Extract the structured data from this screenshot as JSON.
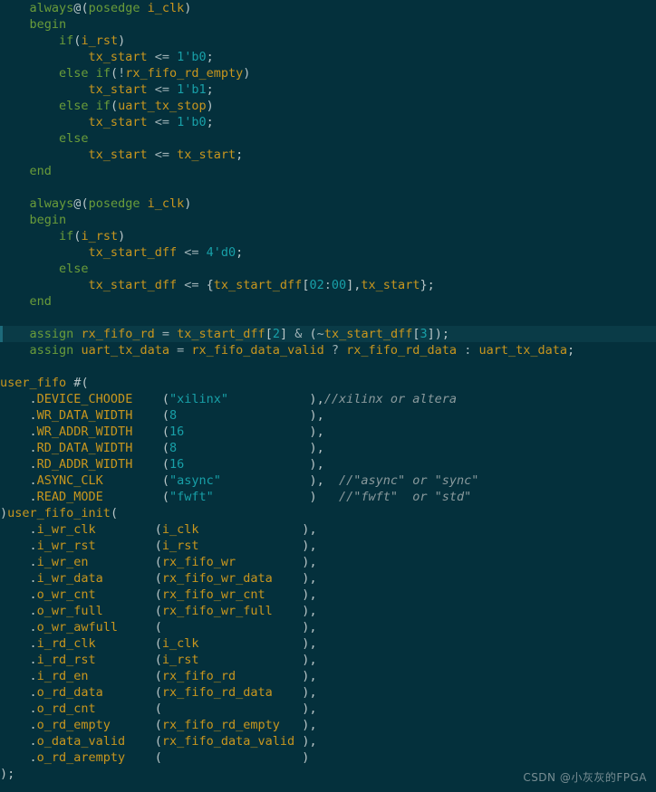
{
  "editor": {
    "language": "verilog",
    "background_color": "#04303c",
    "highlight_color": "#0a3b47",
    "highlight_bar_color": "#1d6a7a",
    "colors": {
      "keyword": "#6a9c3a",
      "identifier": "#c8961e",
      "number": "#18a0a8",
      "string": "#18a0a8",
      "punctuation": "#b9c6c8",
      "operator": "#9fb2b6",
      "comment": "#8a9a9d"
    },
    "highlighted_line_index": 20
  },
  "watermark": {
    "text": "CSDN @小灰灰的FPGA"
  },
  "code": {
    "lines": [
      "    always@(posedge i_clk)",
      "    begin",
      "        if(i_rst)",
      "            tx_start <= 1'b0;",
      "        else if(!rx_fifo_rd_empty)",
      "            tx_start <= 1'b1;",
      "        else if(uart_tx_stop)",
      "            tx_start <= 1'b0;",
      "        else",
      "            tx_start <= tx_start;",
      "    end",
      "",
      "    always@(posedge i_clk)",
      "    begin",
      "        if(i_rst)",
      "            tx_start_dff <= 4'd0;",
      "        else",
      "            tx_start_dff <= {tx_start_dff[02:00],tx_start};",
      "    end",
      "",
      "    assign rx_fifo_rd = tx_start_dff[2] & (~tx_start_dff[3]);",
      "    assign uart_tx_data = rx_fifo_data_valid ? rx_fifo_rd_data : uart_tx_data;",
      "",
      "user_fifo #(",
      "    .DEVICE_CHOODE    (\"xilinx\"           ),//xilinx or altera",
      "    .WR_DATA_WIDTH    (8                  ),",
      "    .WR_ADDR_WIDTH    (16                 ),",
      "    .RD_DATA_WIDTH    (8                  ),",
      "    .RD_ADDR_WIDTH    (16                 ),",
      "    .ASYNC_CLK        (\"async\"            ),  //\"async\" or \"sync\"",
      "    .READ_MODE        (\"fwft\"             )   //\"fwft\"  or \"std\"",
      ")user_fifo_init(",
      "    .i_wr_clk        (i_clk              ),",
      "    .i_wr_rst        (i_rst              ),",
      "    .i_wr_en         (rx_fifo_wr         ),",
      "    .i_wr_data       (rx_fifo_wr_data    ),",
      "    .o_wr_cnt        (rx_fifo_wr_cnt     ),",
      "    .o_wr_full       (rx_fifo_wr_full    ),",
      "    .o_wr_awfull     (                   ),",
      "    .i_rd_clk        (i_clk              ),",
      "    .i_rd_rst        (i_rst              ),",
      "    .i_rd_en         (rx_fifo_rd         ),",
      "    .o_rd_data       (rx_fifo_rd_data    ),",
      "    .o_rd_cnt        (                   ),",
      "    .o_rd_empty      (rx_fifo_rd_empty   ),",
      "    .o_data_valid    (rx_fifo_data_valid ),",
      "    .o_rd_arempty    (                   )",
      ");"
    ]
  }
}
